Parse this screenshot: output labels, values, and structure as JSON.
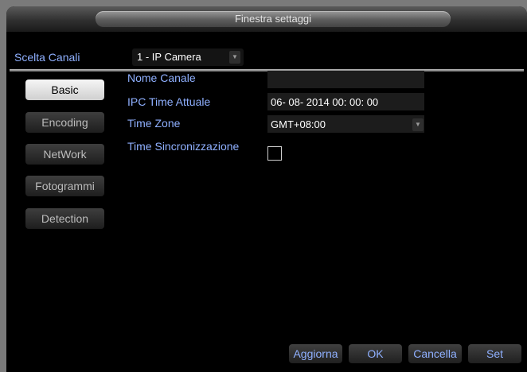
{
  "window": {
    "title": "Finestra settaggi"
  },
  "channel": {
    "label": "Scelta Canali",
    "selected": "1 - IP Camera"
  },
  "sidebar": {
    "items": [
      {
        "label": "Basic",
        "active": true
      },
      {
        "label": "Encoding",
        "active": false
      },
      {
        "label": "NetWork",
        "active": false
      },
      {
        "label": "Fotogrammi",
        "active": false
      },
      {
        "label": "Detection",
        "active": false
      }
    ]
  },
  "form": {
    "channel_name": {
      "label": "Nome Canale",
      "value": ""
    },
    "ipc_time": {
      "label": "IPC Time Attuale",
      "value": "06- 08- 2014  00: 00: 00"
    },
    "time_zone": {
      "label": "Time Zone",
      "value": "GMT+08:00"
    },
    "time_sync": {
      "label": "Time Sincronizzazione",
      "checked": false
    }
  },
  "buttons": {
    "refresh": "Aggiorna",
    "ok": "OK",
    "cancel": "Cancella",
    "set": "Set"
  },
  "icons": {
    "dropdown": "chevron-down-icon"
  },
  "colors": {
    "label_blue": "#8fb0ff",
    "background": "#000000",
    "active_button": "#e6e6e6"
  }
}
